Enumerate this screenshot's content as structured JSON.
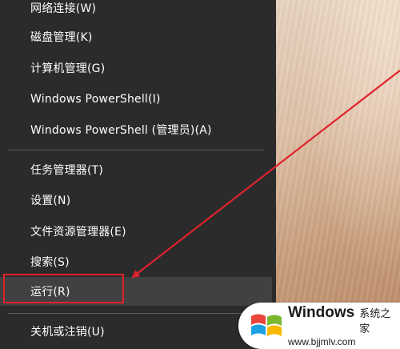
{
  "menu": {
    "items": [
      {
        "label": "网络连接(W)"
      },
      {
        "label": "磁盘管理(K)"
      },
      {
        "label": "计算机管理(G)"
      },
      {
        "label": "Windows PowerShell(I)"
      },
      {
        "label": "Windows PowerShell (管理员)(A)"
      },
      {
        "label": "任务管理器(T)"
      },
      {
        "label": "设置(N)"
      },
      {
        "label": "文件资源管理器(E)"
      },
      {
        "label": "搜索(S)"
      },
      {
        "label": "运行(R)"
      },
      {
        "label": "关机或注销(U)"
      }
    ]
  },
  "annotation": {
    "color": "#e0222c"
  },
  "watermark": {
    "brand": "Windows",
    "subtitle": "系统之家",
    "url": "www.bjjmlv.com",
    "logo_colors": [
      "#e8443a",
      "#7cb82f",
      "#1ba1e2",
      "#f7b800"
    ]
  }
}
